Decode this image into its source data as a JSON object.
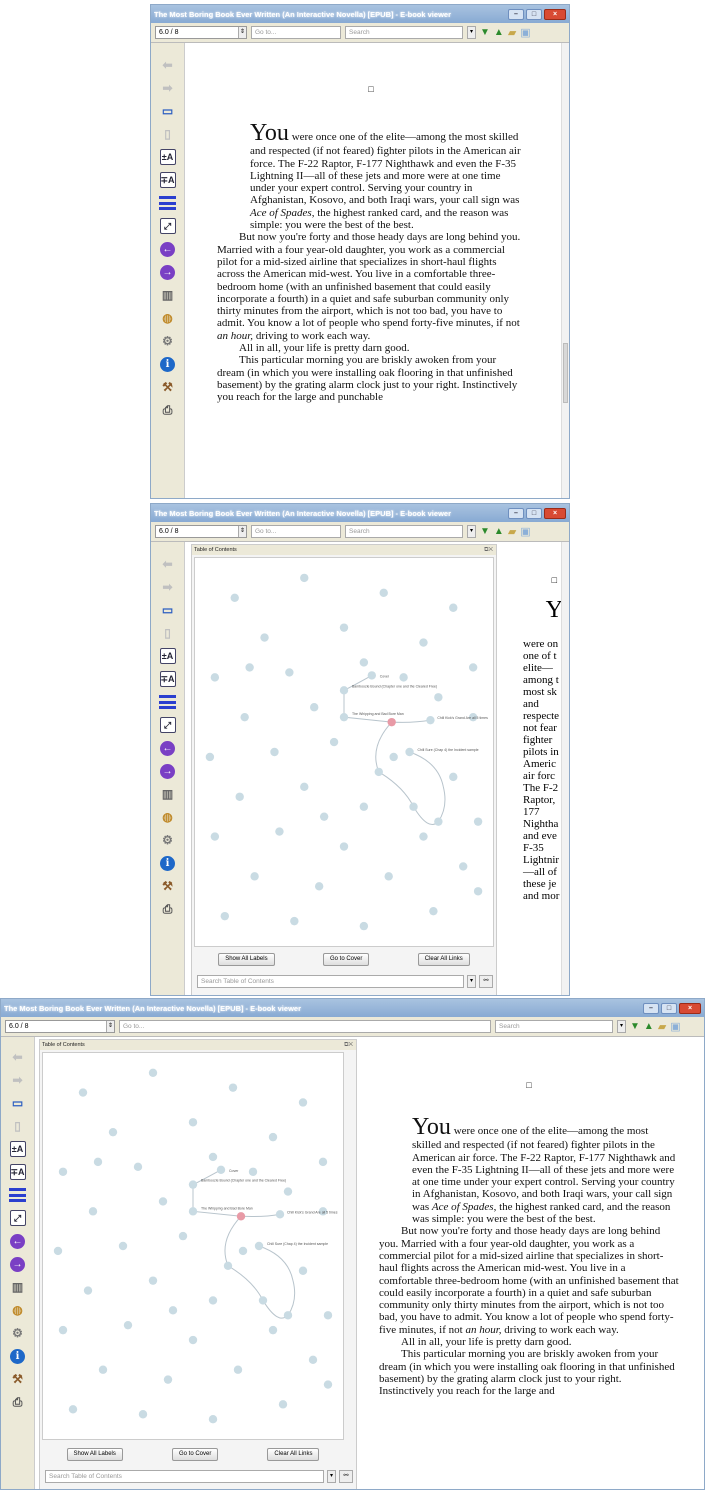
{
  "window": {
    "title": "The Most Boring Book Ever Written (An Interactive Novella) [EPUB] - E-book viewer"
  },
  "toolbar": {
    "position": "6.0 / 8",
    "goto_placeholder": "Go to...",
    "search_placeholder": "Search"
  },
  "toc": {
    "title": "Table of Contents",
    "show_all_labels": "Show All Labels",
    "go_to_cover": "Go to Cover",
    "clear_all_links": "Clear All Links",
    "search_placeholder": "Search Table of Contents",
    "node_labels": [
      "Cover",
      "Bamboozle Bound (Chapter one and the Cleared Free)",
      "The Whipping and Bad Bore Man",
      "Chill Kick's Grand Are all 5 times",
      "Chill Sure (Chap 4) the Incident sample"
    ]
  },
  "book": {
    "first_word": "You",
    "p1_rest": "were once one of the elite—among the most skilled and respected (if not feared) fighter pilots in the American air force.  The F-22 Raptor, F-177 Nighthawk and even the F-35 Lightning II—all of these jets and more were at one time under your expert control.  Serving your country in Afghanistan, Kosovo, and both Iraqi wars, your call sign was ",
    "p1_italic": "Ace of Spades",
    "p1_end": ", the highest ranked card, and the reason was simple: you were the best of the best.",
    "p2_start": "But now you're forty and those heady days are long behind you. Married with a four year-old daughter, you work as a commercial pilot for a mid-sized airline that specializes in short-haul flights across the American mid-west.  You live in a comfortable three-bedroom home (with an unfinished basement that could easily incorporate a fourth) in a quiet and safe suburban community only thirty minutes from the airport, which is not too bad, you have to admit.  You know a lot of people who spend forty-five minutes, if not ",
    "p2_italic": "an hour,",
    "p2_end": " driving to work each way.",
    "p3": "All in all, your life is pretty darn good.",
    "p4": "This particular morning you are briskly awoken from your dream (in which you were installing oak flooring in that unfinished basement) by the grating alarm clock just to your right.  Instinctively you reach for the large and punchable",
    "p4_short": "This particular morning you are briskly awoken from your dream (in which you were installing oak flooring in that unfinished basement) by the grating alarm clock just to your right.  Instinctively you reach for the large and",
    "narrow_words": [
      "were on",
      "one of t",
      "elite—",
      "among t",
      "most sk",
      "and",
      "respecte",
      "not fear",
      "fighter",
      "pilots in",
      "Americ",
      "air forc",
      "The F-2",
      "Raptor,",
      "177",
      "Nightha",
      "and eve",
      "F-35",
      "Lightnir",
      "—all of",
      "these je",
      "and mor"
    ]
  },
  "icons": {
    "back": "left-arrow-icon",
    "forward": "right-arrow-icon",
    "toc": "monitor-icon",
    "bookmarks": "copy-icon",
    "font_larger": "font-larger-icon",
    "font_smaller": "font-smaller-icon",
    "toc_toggle": "lines-icon",
    "fullscreen": "fullscreen-icon",
    "prev": "previous-circle-icon",
    "next": "next-circle-icon",
    "library": "books-icon",
    "reference": "globe-icon",
    "settings": "gear-icon",
    "about": "info-icon",
    "tools": "wand-icon",
    "print": "printer-icon"
  },
  "colors": {
    "accent": "#2b3fcf",
    "nav_purple": "#7a3fc4",
    "highlight_node": "#e89aa6",
    "node": "#c9dbe3",
    "title_bar": "#88aad3"
  }
}
